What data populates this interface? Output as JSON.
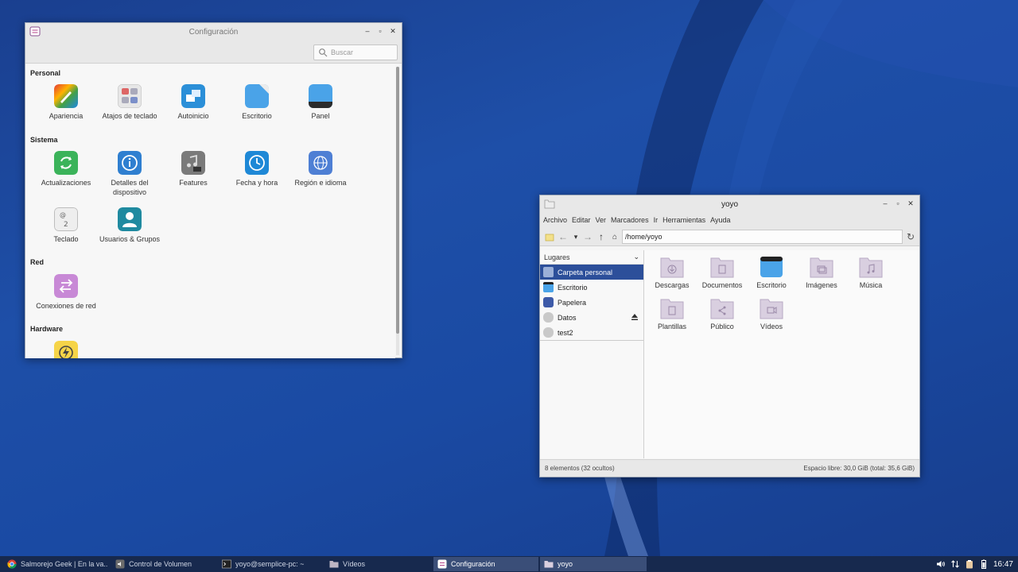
{
  "colors": {
    "desktop": "#1b47a0",
    "taskbar": "#17294e",
    "selection": "#2c4f9a"
  },
  "config_window": {
    "title": "Configuración",
    "search_placeholder": "Buscar",
    "categories": {
      "personal": "Personal",
      "sistema": "Sistema",
      "red": "Red",
      "hardware": "Hardware"
    },
    "items": {
      "apariencia": "Apariencia",
      "atajos": "Atajos de teclado",
      "autoinicio": "Autoinicio",
      "escritorio": "Escritorio",
      "panel": "Panel",
      "actualizaciones": "Actualizaciones",
      "detalles": "Detalles del dispositivo",
      "features": "Features",
      "fecha": "Fecha y hora",
      "region": "Región e idioma",
      "teclado": "Teclado",
      "usuarios": "Usuarios & Grupos",
      "conexiones": "Conexiones de red"
    }
  },
  "file_manager": {
    "title": "yoyo",
    "menu": [
      "Archivo",
      "Editar",
      "Ver",
      "Marcadores",
      "Ir",
      "Herramientas",
      "Ayuda"
    ],
    "path": "/home/yoyo",
    "places_header": "Lugares",
    "places": [
      "Carpeta personal",
      "Escritorio",
      "Papelera",
      "Datos",
      "test2"
    ],
    "folders": [
      "Descargas",
      "Documentos",
      "Escritorio",
      "Imágenes",
      "Música",
      "Plantillas",
      "Público",
      "Vídeos"
    ],
    "status_left": "8 elementos (32 ocultos)",
    "status_right": "Espacio libre: 30,0 GiB (total: 35,6 GiB)"
  },
  "taskbar": {
    "tasks": [
      "Salmorejo Geek | En la va...",
      "Control de Volumen",
      "yoyo@semplice-pc: ~",
      "Vídeos",
      "Configuración",
      "yoyo"
    ],
    "clock": "16:47"
  }
}
